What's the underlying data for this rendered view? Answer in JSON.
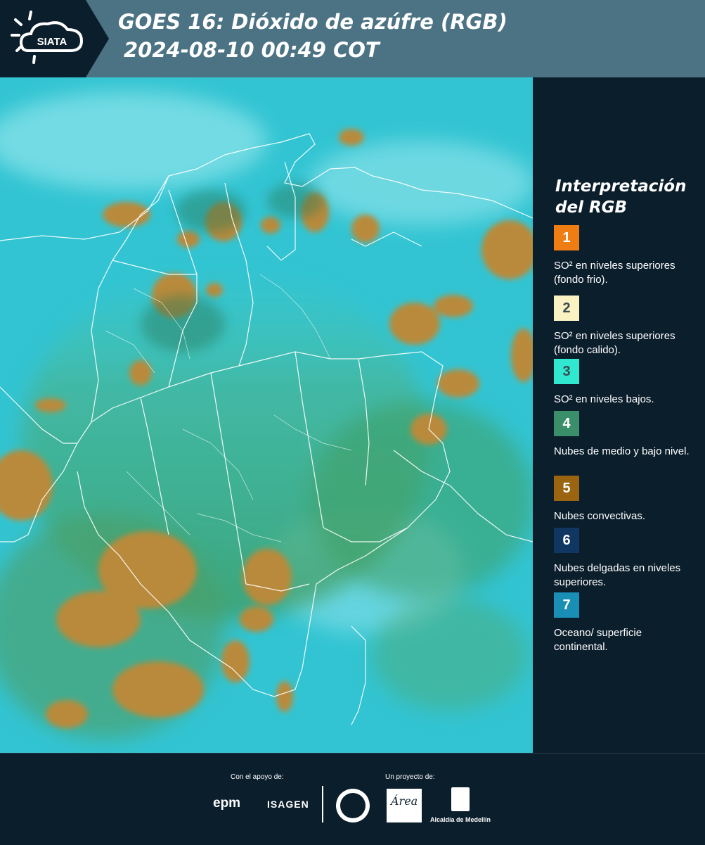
{
  "header": {
    "logo_text": "SIATA",
    "title_line1": "GOES 16: Dióxido de azúfre (RGB)",
    "title_line2": "2024-08-10 00:49 COT"
  },
  "legend": {
    "title_line1": "Interpretación",
    "title_line2": "del RGB",
    "items": [
      {
        "number": "1",
        "color": "#f07c14",
        "text": "SO² en niveles superiores (fondo frio)."
      },
      {
        "number": "2",
        "color": "#fbf2c4",
        "text": "SO² en niveles superiores (fondo calido)."
      },
      {
        "number": "3",
        "color": "#2fe8cf",
        "text": "SO² en niveles bajos."
      },
      {
        "number": "4",
        "color": "#3b8e6a",
        "text": "Nubes de medio y bajo nivel."
      },
      {
        "number": "5",
        "color": "#9a6410",
        "text": "Nubes convectivas."
      },
      {
        "number": "6",
        "color": "#0f3761",
        "text": "Nubes delgadas en niveles superiores."
      },
      {
        "number": "7",
        "color": "#1a8fb5",
        "text": "Oceano/ superficie continental."
      }
    ]
  },
  "footer": {
    "support_label": "Con el apoyo de:",
    "project_label": "Un proyecto de:",
    "epm": "epm",
    "isagen": "ISAGEN",
    "area_logo": "Área",
    "alcaldia": "Alcaldía de Medellín"
  }
}
